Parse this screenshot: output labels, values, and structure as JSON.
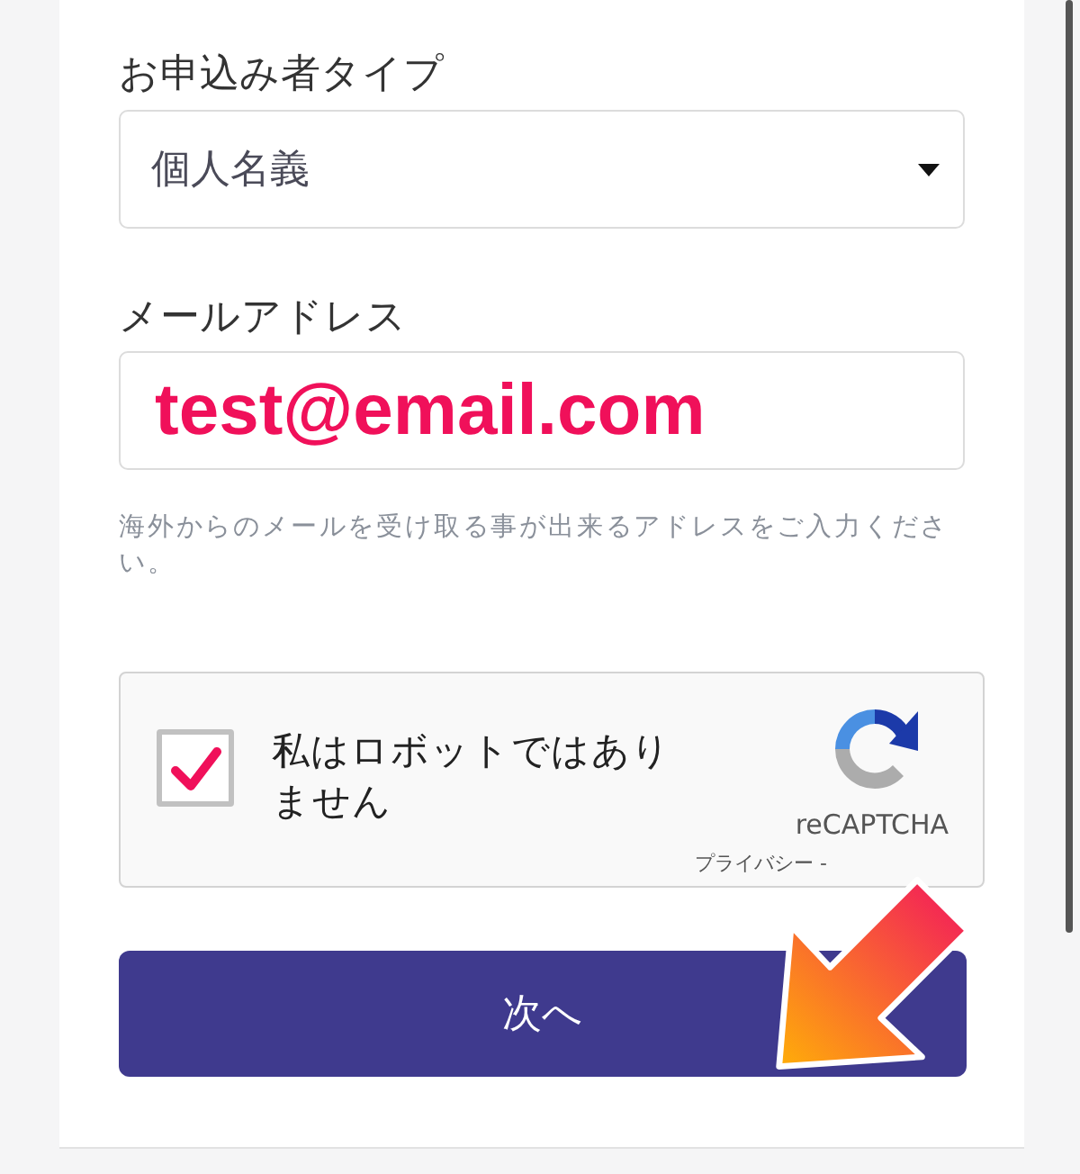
{
  "applicant_type": {
    "label": "お申込み者タイプ",
    "value": "個人名義"
  },
  "email": {
    "label": "メールアドレス",
    "value": "test@email.com",
    "help": "海外からのメールを受け取る事が出来るアドレスをご入力ください。"
  },
  "captcha": {
    "checked": true,
    "label": "私はロボットではありません",
    "brand": "reCAPTCHA",
    "links": "プライバシー -"
  },
  "next_button": {
    "label": "次へ"
  }
}
